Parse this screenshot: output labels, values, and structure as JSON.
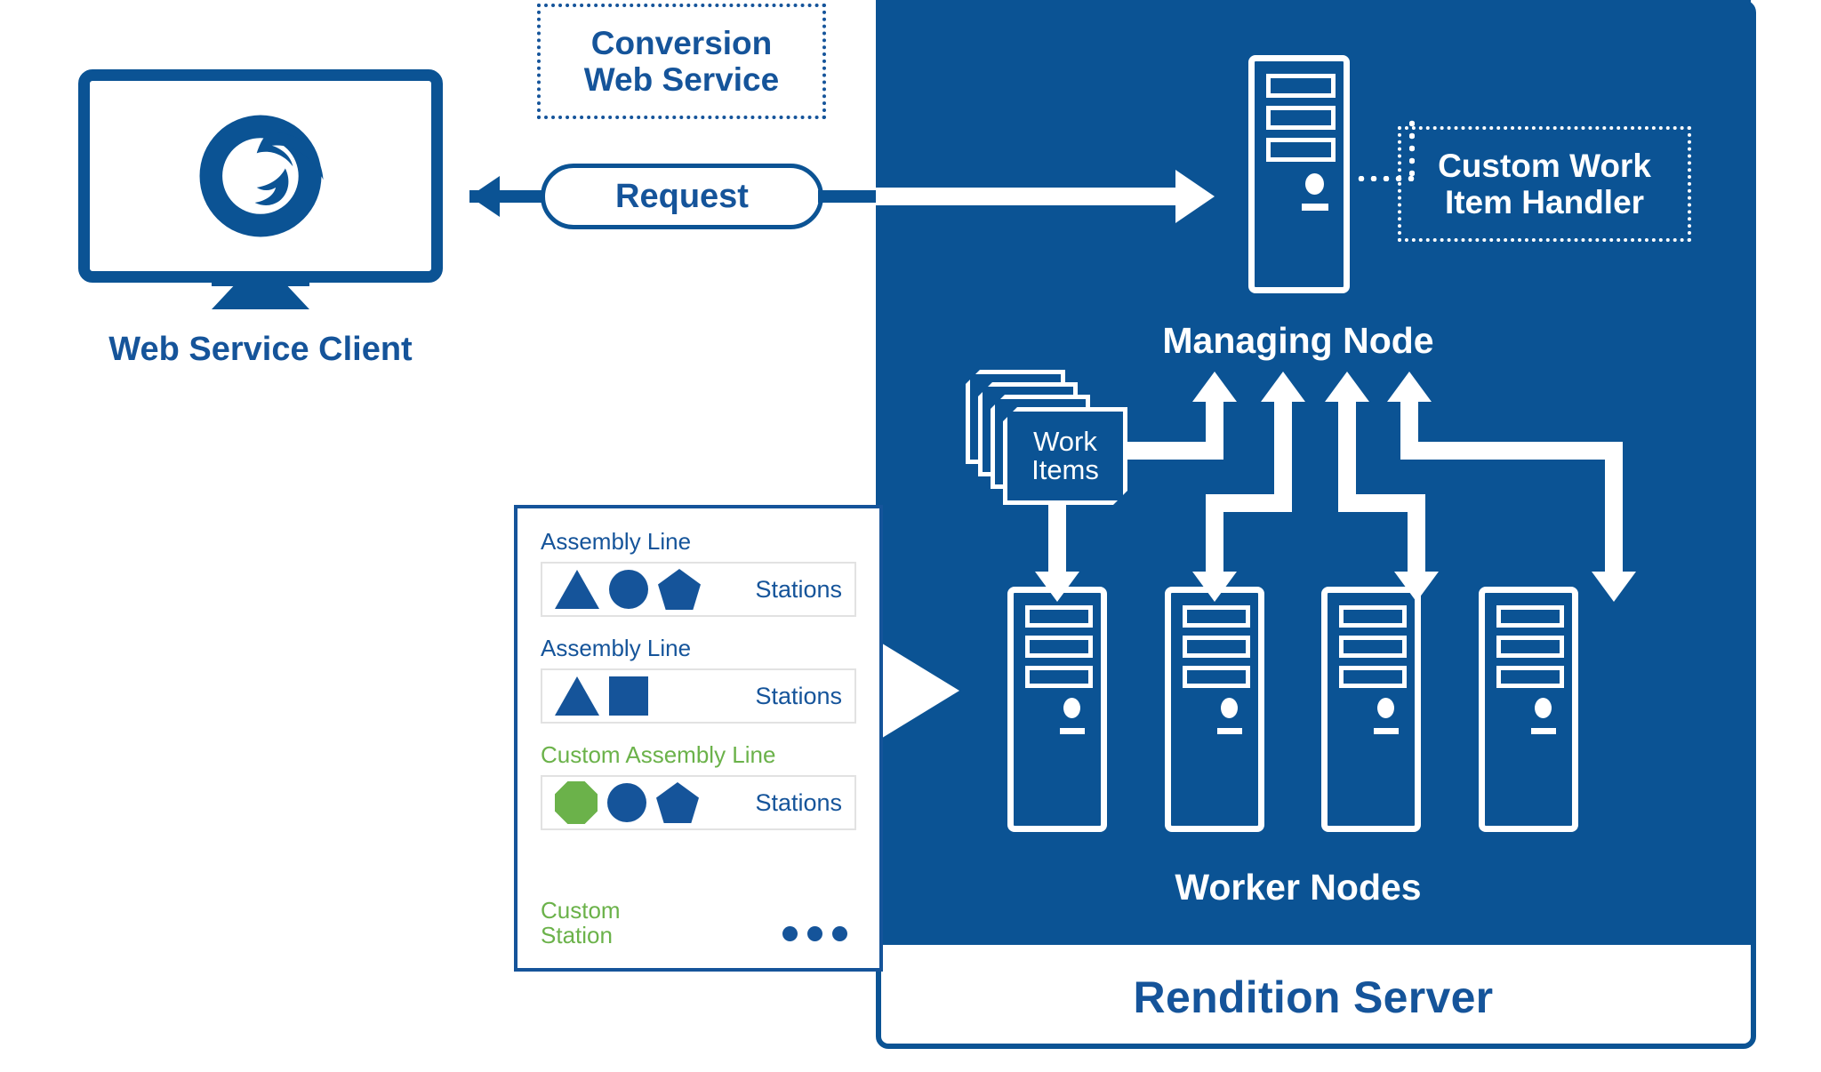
{
  "diagram": {
    "colors": {
      "brand_blue": "#0B5394",
      "text_blue": "#15549A",
      "accent_green": "#6BB24A",
      "white": "#FFFFFF"
    },
    "client": {
      "label": "Web Service Client",
      "logo_icon": "foxit-swirl-logo-icon"
    },
    "conversion_web_service": {
      "line1": "Conversion",
      "line2": "Web Service"
    },
    "request": {
      "label": "Request"
    },
    "managing_node": {
      "label": "Managing Node",
      "icon": "server-tower-icon"
    },
    "custom_work_item_handler": {
      "line1": "Custom Work",
      "line2": "Item Handler"
    },
    "work_items": {
      "line1": "Work",
      "line2": "Items",
      "stack_count": 4
    },
    "worker_nodes": {
      "label": "Worker Nodes",
      "count": 4,
      "icon": "server-tower-icon"
    },
    "rendition_server": {
      "label": "Rendition Server"
    },
    "legend": {
      "rows": [
        {
          "title": "Assembly Line",
          "title_color": "#15549A",
          "shapes": [
            "triangle",
            "circle",
            "pentagon"
          ],
          "shape_colors": [
            "#15549A",
            "#15549A",
            "#15549A"
          ],
          "stations_label": "Stations"
        },
        {
          "title": "Assembly Line",
          "title_color": "#15549A",
          "shapes": [
            "triangle",
            "square"
          ],
          "shape_colors": [
            "#15549A",
            "#15549A"
          ],
          "stations_label": "Stations"
        },
        {
          "title": "Custom Assembly Line",
          "title_color": "#6BB24A",
          "shapes": [
            "octagon",
            "circle",
            "pentagon"
          ],
          "shape_colors": [
            "#6BB24A",
            "#15549A",
            "#15549A"
          ],
          "stations_label": "Stations"
        }
      ],
      "custom_station": {
        "line1": "Custom",
        "line2": "Station"
      },
      "ellipsis": "•••"
    }
  }
}
